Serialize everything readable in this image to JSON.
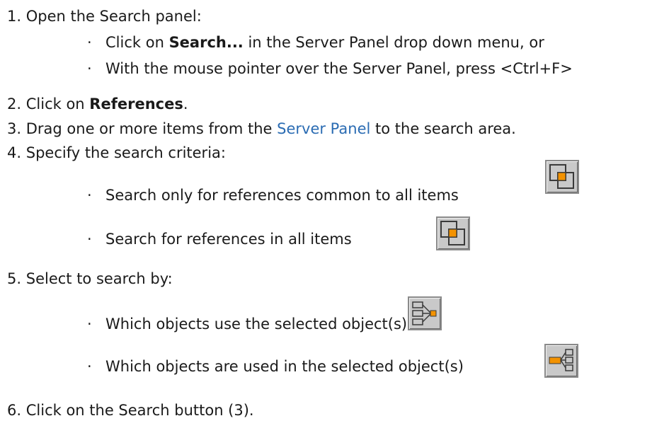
{
  "steps": {
    "s1": {
      "num": "1.",
      "text": "Open the Search panel:",
      "b1": {
        "pre": "Click on ",
        "strong": "Search...",
        "post": " in the Server Panel drop down menu, or"
      },
      "b2": {
        "text": "With the mouse pointer over the Server Panel, press <Ctrl+F>"
      }
    },
    "s2": {
      "num": "2.",
      "pre": "Click on ",
      "strong": "References",
      "post": "."
    },
    "s3": {
      "num": "3.",
      "pre": "Drag one or more items from the ",
      "link": "Server Panel",
      "post": " to the search area."
    },
    "s4": {
      "num": "4.",
      "text": "Specify the search criteria:",
      "b1": {
        "text": "Search only for references common to all items"
      },
      "b2": {
        "text": "Search for references in all items"
      }
    },
    "s5": {
      "num": "5.",
      "text": "Select to search by:",
      "b1": {
        "text": "Which objects use the selected object(s)"
      },
      "b2": {
        "text": "Which objects are used in the selected object(s)"
      }
    },
    "s6": {
      "num": "6.",
      "text": "Click on the Search button (3)."
    }
  },
  "bullet_glyph": "·",
  "icons": {
    "common_items": "overlapping-squares-icon",
    "all_items": "overlapping-squares-icon",
    "uses_objects": "uses-objects-tree-icon",
    "used_in_objects": "used-in-objects-tree-icon"
  },
  "colors": {
    "text": "#1a1a1a",
    "link": "#2b6cb3",
    "icon_accent": "#f39200",
    "icon_bg": "#c9c9c9"
  }
}
